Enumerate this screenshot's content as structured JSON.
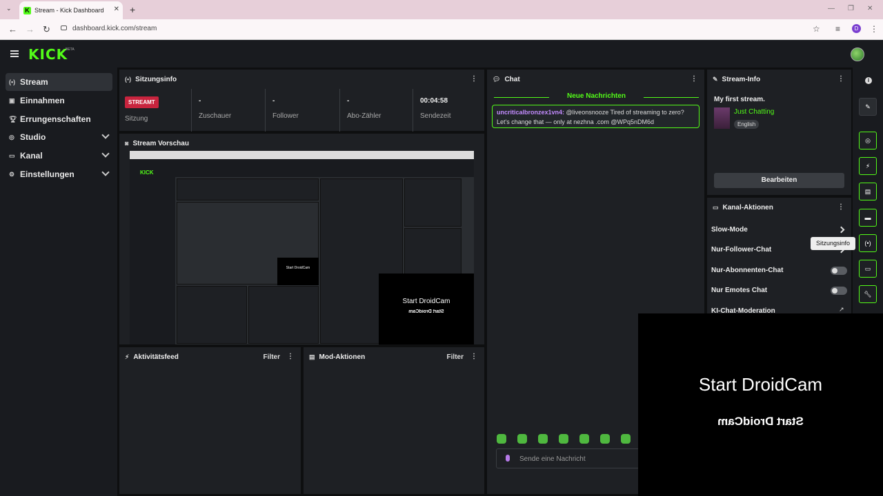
{
  "browser": {
    "tab_title": "Stream - Kick Dashboard",
    "url": "dashboard.kick.com/stream",
    "profile_initial": "D"
  },
  "brand": {
    "logo": "KICK",
    "beta": "BETA",
    "accent": "#53fc18"
  },
  "sidebar": {
    "items": [
      {
        "label": "Stream",
        "icon": "broadcast-icon",
        "active": true
      },
      {
        "label": "Einnahmen",
        "icon": "wallet-icon"
      },
      {
        "label": "Errungenschaften",
        "icon": "trophy-icon"
      },
      {
        "label": "Studio",
        "icon": "studio-icon",
        "expandable": true
      },
      {
        "label": "Kanal",
        "icon": "channel-icon",
        "expandable": true
      },
      {
        "label": "Einstellungen",
        "icon": "gear-icon",
        "expandable": true
      }
    ]
  },
  "session": {
    "title": "Sitzungsinfo",
    "status_badge": "STREAMT",
    "status_label": "Sitzung",
    "viewers_value": "-",
    "viewers_label": "Zuschauer",
    "followers_value": "-",
    "followers_label": "Follower",
    "subs_value": "-",
    "subs_label": "Abo-Zähler",
    "time_value": "00:04:58",
    "time_label": "Sendezeit"
  },
  "preview": {
    "title": "Stream Vorschau",
    "cam_text": "Start DroidCam"
  },
  "activity": {
    "title": "Aktivitätsfeed",
    "filter": "Filter"
  },
  "mod": {
    "title": "Mod-Aktionen",
    "filter": "Filter"
  },
  "chat": {
    "title": "Chat",
    "new_messages": "Neue Nachrichten",
    "message_user": "uncriticalbronzex1vn4:",
    "message_text": "@liveonsnooze Tired of streaming to zero? Let's change that — only at nezhna .com @WPq5nDM6d",
    "input_placeholder": "Sende eine Nachricht"
  },
  "stream_info": {
    "title": "Stream-Info",
    "stream_title": "My first stream.",
    "category": "Just Chatting",
    "language": "English",
    "edit_button": "Bearbeiten"
  },
  "channel_actions": {
    "title": "Kanal-Aktionen",
    "items": [
      {
        "label": "Slow-Mode",
        "control": "chevron"
      },
      {
        "label": "Nur-Follower-Chat",
        "control": "chevron"
      },
      {
        "label": "Nur-Abonnenten-Chat",
        "control": "toggle"
      },
      {
        "label": "Nur Emotes Chat",
        "control": "toggle"
      },
      {
        "label": "KI-Chat-Moderation",
        "control": "external"
      }
    ]
  },
  "tooltip": "Sitzungsinfo",
  "overlay": {
    "text": "Start DroidCam"
  }
}
